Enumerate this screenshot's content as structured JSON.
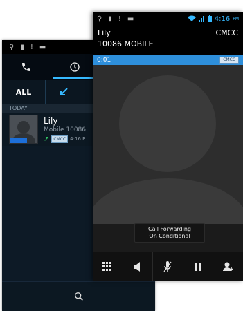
{
  "call_log": {
    "filters": {
      "all_label": "ALL"
    },
    "section_label": "TODAY",
    "entries": [
      {
        "name": "Lily",
        "detail": "Mobile 10086",
        "carrier": "CMCC",
        "time": "4:16 P"
      }
    ]
  },
  "in_call": {
    "status": {
      "time": "4:16",
      "ampm": "PM"
    },
    "caller_name": "Lily",
    "carrier": "CMCC",
    "number_line": "10086 MOBILE",
    "timer": "0:01",
    "timer_carrier": "CMCC",
    "tooltip": [
      "Call Forwarding",
      "On Conditional"
    ]
  },
  "icons": {
    "phone_tab": "phone-icon",
    "history_tab": "clock-icon",
    "incoming_filter": "incoming-arrow-icon",
    "search": "search-icon",
    "dialpad": "dialpad-icon",
    "speaker": "speaker-icon",
    "mute": "mute-icon",
    "hold": "pause-icon",
    "add_call": "add-call-icon"
  },
  "colors": {
    "accent": "#36b9ff",
    "call_bar": "#2e8fdb",
    "end_area": "#6c0d14"
  }
}
